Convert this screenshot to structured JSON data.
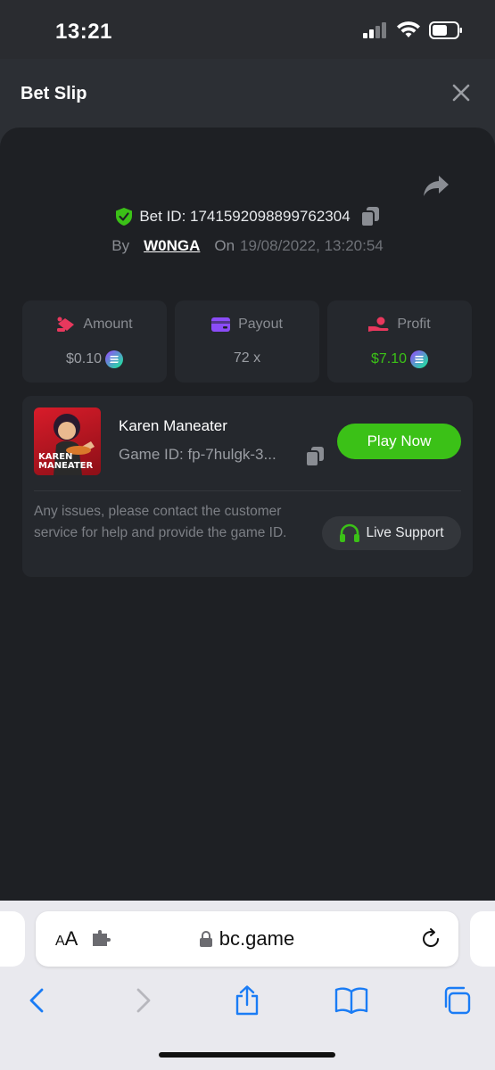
{
  "status_bar": {
    "time": "13:21"
  },
  "header": {
    "title": "Bet Slip"
  },
  "bet": {
    "id_label": "Bet ID: 1741592098899762304",
    "by_label": "By",
    "user": "W0NGA",
    "on_label": "On",
    "date": "19/08/2022, 13:20:54"
  },
  "stats": {
    "amount": {
      "label": "Amount",
      "value": "$0.10"
    },
    "payout": {
      "label": "Payout",
      "value": "72 x"
    },
    "profit": {
      "label": "Profit",
      "value": "$7.10",
      "color": "#3bc117"
    }
  },
  "game": {
    "thumb_text_1": "KAREN",
    "thumb_text_2": "MANEATER",
    "name": "Karen Maneater",
    "game_id": "Game ID: fp-7hulgk-3...",
    "play_label": "Play Now",
    "issues_text": "Any issues, please contact the customer service for help and provide the game ID.",
    "support_label": "Live Support"
  },
  "browser": {
    "aa_label": "AA",
    "url": "bc.game"
  },
  "colors": {
    "accent_green": "#3bc117",
    "panel_bg": "#1e2024",
    "card_bg": "#25282d"
  }
}
